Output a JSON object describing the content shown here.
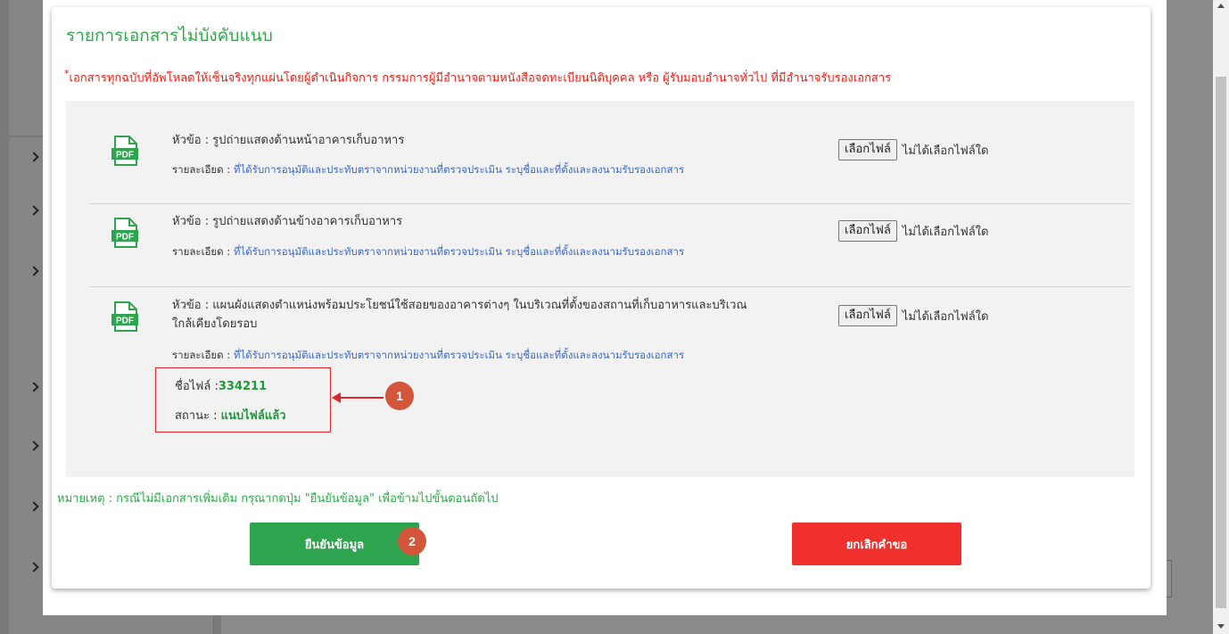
{
  "section_title": "รายการเอกสารไม่บังคับแนบ",
  "notice": {
    "star": "*",
    "text": "เอกสารทุกฉบับที่อัพโหลดให้เซ็นจริงทุกแผ่นโดยผู้ดำเนินกิจการ กรรมการผู้มีอำนาจตามหนังสือจดทะเบียนนิติบุคคล หรือ ผู้รับมอบอำนาจทั่วไป ที่มีอำนาจรับรองเอกสาร"
  },
  "documents": [
    {
      "title_prefix": "หัวข้อ : ",
      "title": "รูปถ่ายแสดงด้านหน้าอาคารเก็บอาหาร",
      "detail_prefix": "รายละเอียด : ",
      "detail": "ที่ได้รับการอนุมัติและประทับตราจากหน่วยงานที่ตรวจประเมิน ระบุชื่อและที่ตั้งและลงนามรับรองเอกสาร",
      "choose_label": "เลือกไฟล์",
      "no_file": "ไม่ได้เลือกไฟล์ใด"
    },
    {
      "title_prefix": "หัวข้อ : ",
      "title": "รูปถ่ายแสดงด้านข้างอาคารเก็บอาหาร",
      "detail_prefix": "รายละเอียด : ",
      "detail": "ที่ได้รับการอนุมัติและประทับตราจากหน่วยงานที่ตรวจประเมิน ระบุชื่อและที่ตั้งและลงนามรับรองเอกสาร",
      "choose_label": "เลือกไฟล์",
      "no_file": "ไม่ได้เลือกไฟล์ใด"
    },
    {
      "title_prefix": "หัวข้อ : ",
      "title_line1": "แผนผังแสดงตำแหน่งพร้อมประโยชน์ใช้สอยของอาคารต่างๆ ในบริเวณที่ตั้งของสถานที่เก็บอาหารและบริเวณ",
      "title_line2": "ใกล้เคียงโดยรอบ",
      "detail_prefix": "รายละเอียด : ",
      "detail": "ที่ได้รับการอนุมัติและประทับตราจากหน่วยงานที่ตรวจประเมิน ระบุชื่อและที่ตั้งและลงนามรับรองเอกสาร",
      "choose_label": "เลือกไฟล์",
      "no_file": "ไม่ได้เลือกไฟล์ใด",
      "file_name_label": "ชื่อไฟล์ :",
      "file_name": "334211",
      "status_label": "สถานะ : ",
      "status": "แนบไฟล์แล้ว"
    }
  ],
  "pdf_icon_text": "PDF",
  "step_badges": [
    "1",
    "2"
  ],
  "remark": "หมายเหตุ : กรณีไม่มีเอกสารเพิ่มเติม กรุณากดปุ่ม \"ยืนยันข้อมูล\" เพื่อข้ามไปขั้นตอนถัดไป",
  "buttons": {
    "confirm": "ยืนยันข้อมูล",
    "cancel": "ยกเลิกคำขอ"
  },
  "colors": {
    "green": "#2ea44f",
    "red": "#f0302c",
    "badge": "#d2563a",
    "link": "#3a68c4"
  }
}
